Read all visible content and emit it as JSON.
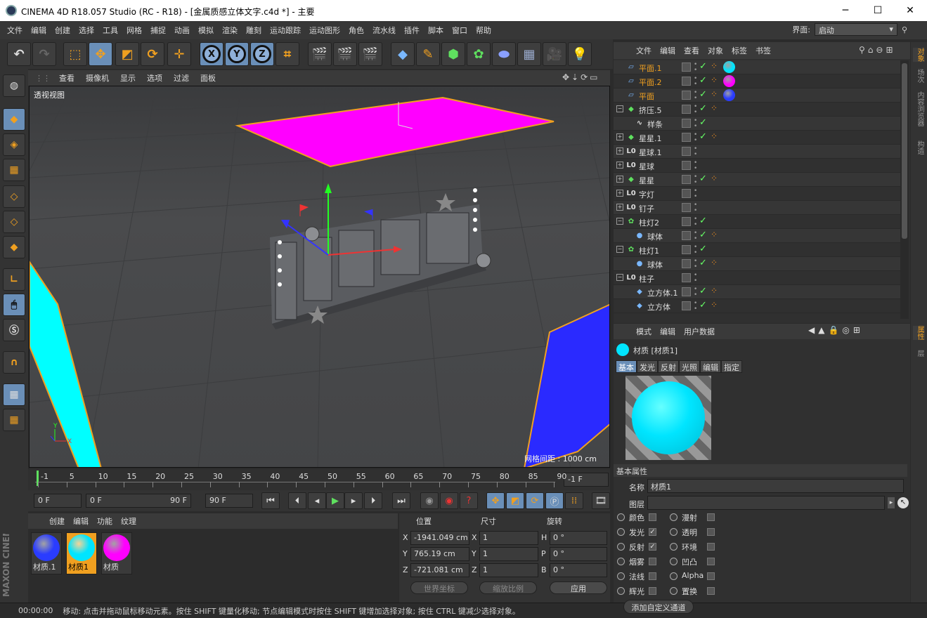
{
  "title_bar": {
    "title": "CINEMA 4D R18.057 Studio (RC - R18) - [金属质感立体文字.c4d *] - 主要",
    "minimize": "─",
    "maximize": "☐",
    "close": "✕"
  },
  "menu": [
    "文件",
    "编辑",
    "创建",
    "选择",
    "工具",
    "网格",
    "捕捉",
    "动画",
    "模拟",
    "渲染",
    "雕刻",
    "运动跟踪",
    "运动图形",
    "角色",
    "流水线",
    "插件",
    "脚本",
    "窗口",
    "帮助"
  ],
  "layout": {
    "label": "界面:",
    "value": "启动"
  },
  "toolbar": {
    "x": "X",
    "y": "Y",
    "z": "Z"
  },
  "viewport": {
    "menu": [
      "查看",
      "摄像机",
      "显示",
      "选项",
      "过滤",
      "面板"
    ],
    "label": "透视视图",
    "grid_spacing": "网格间距 : 1000 cm",
    "axis_x": "X",
    "axis_y": "Y",
    "colors": {
      "plane_magenta": "#ff00ff",
      "plane_cyan": "#00ffff",
      "plane_blue": "#2a2aff",
      "selection": "#f0a020"
    }
  },
  "timeline": {
    "ticks": [
      "-1",
      "5",
      "10",
      "15",
      "20",
      "25",
      "30",
      "35",
      "40",
      "45",
      "50",
      "55",
      "60",
      "65",
      "70",
      "75",
      "80",
      "85",
      "90"
    ],
    "current_frame": "-1 F"
  },
  "transport": {
    "start": "0 F",
    "range_start": "0 F",
    "range_end": "90 F",
    "end": "90 F"
  },
  "materials": {
    "menu": [
      "创建",
      "编辑",
      "功能",
      "纹理"
    ],
    "items": [
      {
        "name": "材质.1",
        "color": "#2a3cff",
        "selected": false
      },
      {
        "name": "材质1",
        "color": "#00e5ff",
        "selected": true
      },
      {
        "name": "材质",
        "color": "#ff00ff",
        "selected": false
      }
    ]
  },
  "coords": {
    "headers": [
      "位置",
      "尺寸",
      "旋转"
    ],
    "rows": [
      {
        "axis": "X",
        "pos": "-1941.049 cm",
        "size_axis": "X",
        "size": "1",
        "rot_axis": "H",
        "rot": "0 °"
      },
      {
        "axis": "Y",
        "pos": "765.19 cm",
        "size_axis": "Y",
        "size": "1",
        "rot_axis": "P",
        "rot": "0 °"
      },
      {
        "axis": "Z",
        "pos": "-721.081 cm",
        "size_axis": "Z",
        "size": "1",
        "rot_axis": "B",
        "rot": "0 °"
      }
    ],
    "world": "世界坐标",
    "scale": "缩放比例",
    "apply": "应用"
  },
  "brand": "MAXON CINEMA 4D",
  "status": {
    "time": "00:00:00",
    "message": "移动: 点击并拖动鼠标移动元素。按住 SHIFT 键量化移动; 节点编辑模式时按住 SHIFT 键增加选择对象; 按住 CTRL 键减少选择对象。"
  },
  "objects_panel": {
    "menu": [
      "文件",
      "编辑",
      "查看",
      "对象",
      "标签",
      "书签"
    ],
    "rows": [
      {
        "name": "平面.1",
        "icon": "plane-icon",
        "indent": 0,
        "expand": "",
        "highlight": true,
        "check": true,
        "tags": 1,
        "ball": "#00e5ff"
      },
      {
        "name": "平面.2",
        "icon": "plane-icon",
        "indent": 0,
        "expand": "",
        "highlight": true,
        "check": true,
        "tags": 1,
        "ball": "#ff00ff"
      },
      {
        "name": "平面",
        "icon": "plane-icon",
        "indent": 0,
        "expand": "",
        "highlight": true,
        "check": true,
        "tags": 1,
        "ball": "#2a3cff"
      },
      {
        "name": "挤压.5",
        "icon": "extrude-icon",
        "indent": 0,
        "expand": "−",
        "highlight": false,
        "check": true,
        "tags": 1,
        "ball": ""
      },
      {
        "name": "样条",
        "icon": "spline-icon",
        "indent": 1,
        "expand": "",
        "highlight": false,
        "check": true,
        "tags": 0,
        "ball": ""
      },
      {
        "name": "星星.1",
        "icon": "extrude-icon",
        "indent": 0,
        "expand": "+",
        "highlight": false,
        "check": true,
        "tags": 1,
        "ball": ""
      },
      {
        "name": "星球.1",
        "icon": "null-icon",
        "indent": 0,
        "expand": "+",
        "highlight": false,
        "check": false,
        "tags": 0,
        "ball": ""
      },
      {
        "name": "星球",
        "icon": "null-icon",
        "indent": 0,
        "expand": "+",
        "highlight": false,
        "check": false,
        "tags": 0,
        "ball": ""
      },
      {
        "name": "星星",
        "icon": "extrude-icon",
        "indent": 0,
        "expand": "+",
        "highlight": false,
        "check": true,
        "tags": 1,
        "ball": ""
      },
      {
        "name": "字灯",
        "icon": "null-icon",
        "indent": 0,
        "expand": "+",
        "highlight": false,
        "check": false,
        "tags": 0,
        "ball": ""
      },
      {
        "name": "钉子",
        "icon": "null-icon",
        "indent": 0,
        "expand": "+",
        "highlight": false,
        "check": false,
        "tags": 0,
        "ball": ""
      },
      {
        "name": "柱灯2",
        "icon": "cloner-icon",
        "indent": 0,
        "expand": "−",
        "highlight": false,
        "check": true,
        "tags": 0,
        "ball": ""
      },
      {
        "name": "球体",
        "icon": "sphere-icon",
        "indent": 1,
        "expand": "",
        "highlight": false,
        "check": true,
        "tags": 1,
        "ball": ""
      },
      {
        "name": "柱灯1",
        "icon": "cloner-icon",
        "indent": 0,
        "expand": "−",
        "highlight": false,
        "check": true,
        "tags": 0,
        "ball": ""
      },
      {
        "name": "球体",
        "icon": "sphere-icon",
        "indent": 1,
        "expand": "",
        "highlight": false,
        "check": true,
        "tags": 1,
        "ball": ""
      },
      {
        "name": "柱子",
        "icon": "null-icon",
        "indent": 0,
        "expand": "−",
        "highlight": false,
        "check": false,
        "tags": 0,
        "ball": ""
      },
      {
        "name": "立方体.1",
        "icon": "cube-icon",
        "indent": 1,
        "expand": "",
        "highlight": false,
        "check": true,
        "tags": 1,
        "ball": ""
      },
      {
        "name": "立方体",
        "icon": "cube-icon",
        "indent": 1,
        "expand": "",
        "highlight": false,
        "check": true,
        "tags": 1,
        "ball": ""
      }
    ]
  },
  "right_tabs_top": [
    "对象",
    "场次",
    "内容浏览器",
    "构造"
  ],
  "right_tabs_bottom": [
    "属性",
    "层"
  ],
  "attributes": {
    "menu": [
      "模式",
      "编辑",
      "用户数据"
    ],
    "header": "材质 [材质1]",
    "tabs": [
      "基本",
      "发光",
      "反射",
      "光照",
      "编辑",
      "指定"
    ],
    "section": "基本属性",
    "name_label": "名称",
    "name_value": "材质1",
    "layer_label": "图层",
    "channels_left": [
      {
        "label": "颜色",
        "checked": false
      },
      {
        "label": "发光",
        "checked": true
      },
      {
        "label": "反射",
        "checked": true
      },
      {
        "label": "烟雾",
        "checked": false
      },
      {
        "label": "法线",
        "checked": false
      },
      {
        "label": "辉光",
        "checked": false
      }
    ],
    "channels_right": [
      {
        "label": "漫射",
        "checked": false
      },
      {
        "label": "透明",
        "checked": false
      },
      {
        "label": "环境",
        "checked": false
      },
      {
        "label": "凹凸",
        "checked": false
      },
      {
        "label": "Alpha",
        "checked": false
      },
      {
        "label": "置换",
        "checked": false
      }
    ],
    "add_channel": "添加自定义通道",
    "preview_color": "#00e5ff"
  }
}
